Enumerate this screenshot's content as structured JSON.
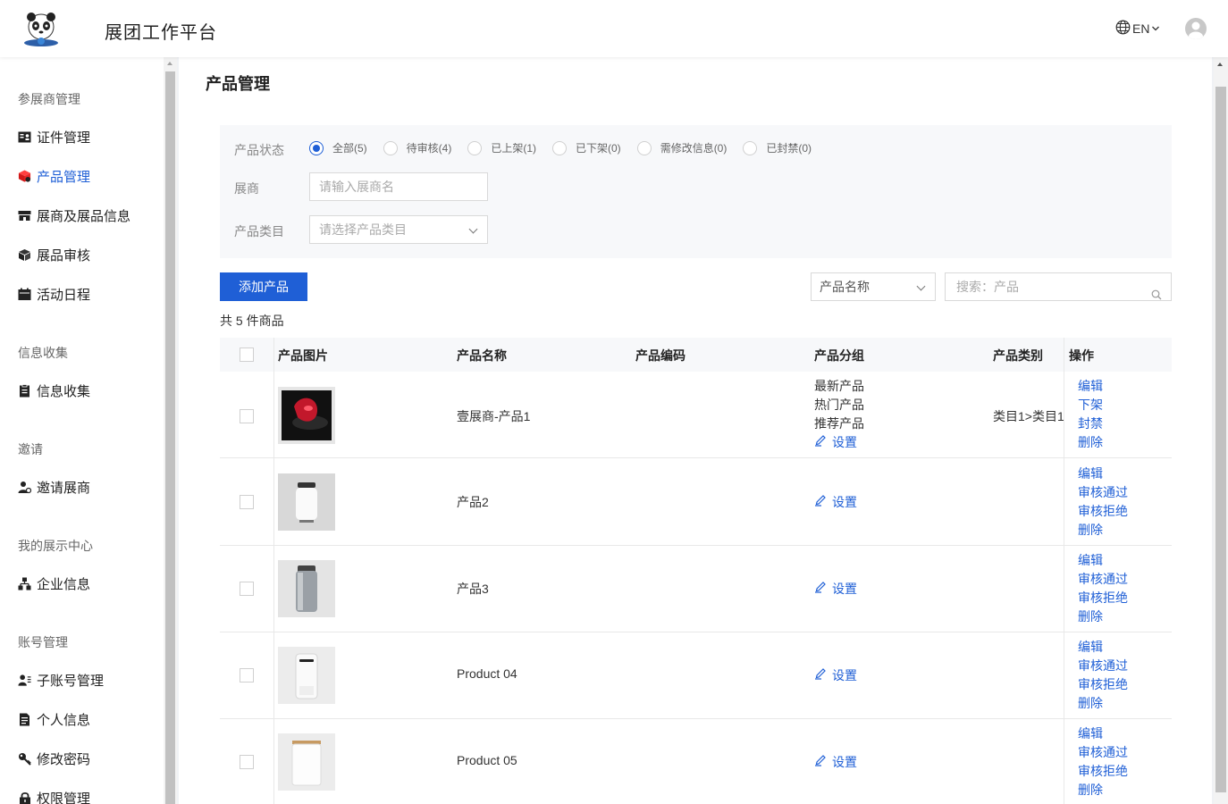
{
  "header": {
    "title": "展团工作平台",
    "lang": "EN"
  },
  "sidebar": {
    "groups": [
      {
        "label": "参展商管理",
        "items": [
          {
            "label": "证件管理",
            "icon": "id-card-icon"
          },
          {
            "label": "产品管理",
            "icon": "product-cube-icon",
            "active": true
          },
          {
            "label": "展商及展品信息",
            "icon": "store-icon"
          },
          {
            "label": "展品审核",
            "icon": "box-icon"
          },
          {
            "label": "活动日程",
            "icon": "calendar-icon"
          }
        ]
      },
      {
        "label": "信息收集",
        "items": [
          {
            "label": "信息收集",
            "icon": "clipboard-icon"
          }
        ]
      },
      {
        "label": "邀请",
        "items": [
          {
            "label": "邀请展商",
            "icon": "invite-user-icon"
          }
        ]
      },
      {
        "label": "我的展示中心",
        "items": [
          {
            "label": "企业信息",
            "icon": "org-chart-icon"
          }
        ]
      },
      {
        "label": "账号管理",
        "items": [
          {
            "label": "子账号管理",
            "icon": "user-list-icon"
          },
          {
            "label": "个人信息",
            "icon": "document-icon"
          },
          {
            "label": "修改密码",
            "icon": "key-icon"
          },
          {
            "label": "权限管理",
            "icon": "lock-icon"
          }
        ]
      }
    ]
  },
  "main": {
    "page_title": "产品管理",
    "filter": {
      "status_label": "产品状态",
      "status_options": [
        "全部(5)",
        "待审核(4)",
        "已上架(1)",
        "已下架(0)",
        "需修改信息(0)",
        "已封禁(0)"
      ],
      "selected_status": "全部(5)",
      "exhibitor_label": "展商",
      "exhibitor_placeholder": "请输入展商名",
      "category_label": "产品类目",
      "category_placeholder": "请选择产品类目"
    },
    "add_button": "添加产品",
    "search_field": "产品名称",
    "search_placeholder": "搜索：产品",
    "total": "共 5 件商品",
    "columns": [
      "产品图片",
      "产品名称",
      "产品编码",
      "产品分组",
      "产品类别",
      "操作"
    ],
    "rows": [
      {
        "name": "壹展商-产品1",
        "code": "",
        "groups": [
          "最新产品",
          "热门产品",
          "推荐产品"
        ],
        "setting": "设置",
        "category": "类目1>类目1",
        "ops": [
          "编辑",
          "下架",
          "封禁",
          "删除"
        ],
        "img_color": "#c2182b"
      },
      {
        "name": "产品2",
        "code": "",
        "groups": [],
        "setting": "设置",
        "category": "",
        "ops": [
          "编辑",
          "审核通过",
          "审核拒绝",
          "删除"
        ],
        "img_color": "#f4f4f4"
      },
      {
        "name": "产品3",
        "code": "",
        "groups": [],
        "setting": "设置",
        "category": "",
        "ops": [
          "编辑",
          "审核通过",
          "审核拒绝",
          "删除"
        ],
        "img_color": "#9aa0a6"
      },
      {
        "name": "Product 04",
        "code": "",
        "groups": [],
        "setting": "设置",
        "category": "",
        "ops": [
          "编辑",
          "审核通过",
          "审核拒绝",
          "删除"
        ],
        "img_color": "#fafafa"
      },
      {
        "name": "Product 05",
        "code": "",
        "groups": [],
        "setting": "设置",
        "category": "",
        "ops": [
          "编辑",
          "审核通过",
          "审核拒绝",
          "删除"
        ],
        "img_color": "#fbfbfb"
      }
    ]
  },
  "colors": {
    "primary": "#1f5fd6",
    "active_icon": "#e02020"
  }
}
